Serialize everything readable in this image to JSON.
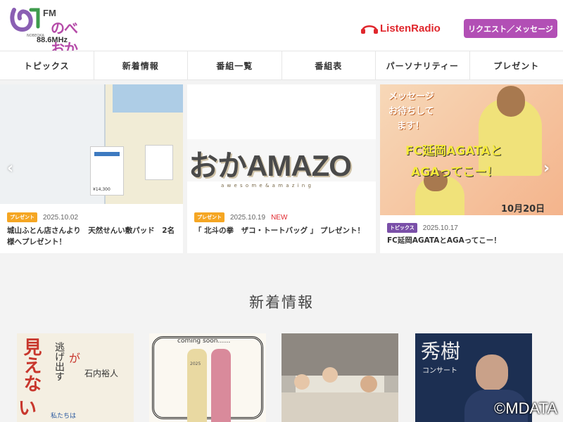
{
  "logo": {
    "fm": "FM",
    "jp": "のべおか",
    "small": "NOBEOKA",
    "freq": "88.6MHz"
  },
  "header": {
    "listen_label": "ListenRadio",
    "request_button": "リクエスト／メッセージ"
  },
  "nav": [
    {
      "label": "トピックス"
    },
    {
      "label": "新着情報"
    },
    {
      "label": "番組一覧"
    },
    {
      "label": "番組表"
    },
    {
      "label": "パーソナリティー"
    },
    {
      "label": "プレゼント"
    }
  ],
  "slider": {
    "prev": "‹",
    "next": "›",
    "cards": [
      {
        "tag": "プレゼント",
        "tag_color": "#f5a623",
        "date": "2025.10.02",
        "new": "",
        "title": "城山ふとん店さんより　天然せんい敷パッド　2名様へプレゼント！",
        "img_label": "¥14,300"
      },
      {
        "tag": "プレゼント",
        "tag_color": "#f5a623",
        "date": "2025.10.19",
        "new": "NEW",
        "title": "「 北斗の拳　ザコ・トートバッグ 」 プレゼント！",
        "img_text": "おかAMAZO",
        "img_sub": "a w e s o m e   &   a m a z i n g"
      },
      {
        "tag": "トピックス",
        "tag_color": "#7a4fa8",
        "date": "2025.10.17",
        "new": "",
        "title": "FC延岡AGATAとAGAってこー！",
        "img_msg1": "メッセージ",
        "img_msg2": "お待ちして",
        "img_msg3": "ます！",
        "img_big1": "FC延岡AGATAと",
        "img_big2": "AGAってこー！",
        "img_date": "10月20日"
      }
    ]
  },
  "section": {
    "title": "新着情報"
  },
  "thumbs": [
    {
      "line1": "見えな",
      "line2": "逃げ出す",
      "line3": "石内裕人",
      "line4": "が",
      "line5": "い",
      "line6": "私たちは"
    },
    {
      "text": "coming soon……",
      "year": "2025"
    },
    {
      "text": ""
    },
    {
      "line1": "秀樹",
      "line2": "コンサート"
    }
  ],
  "copyright": "©MDATA"
}
